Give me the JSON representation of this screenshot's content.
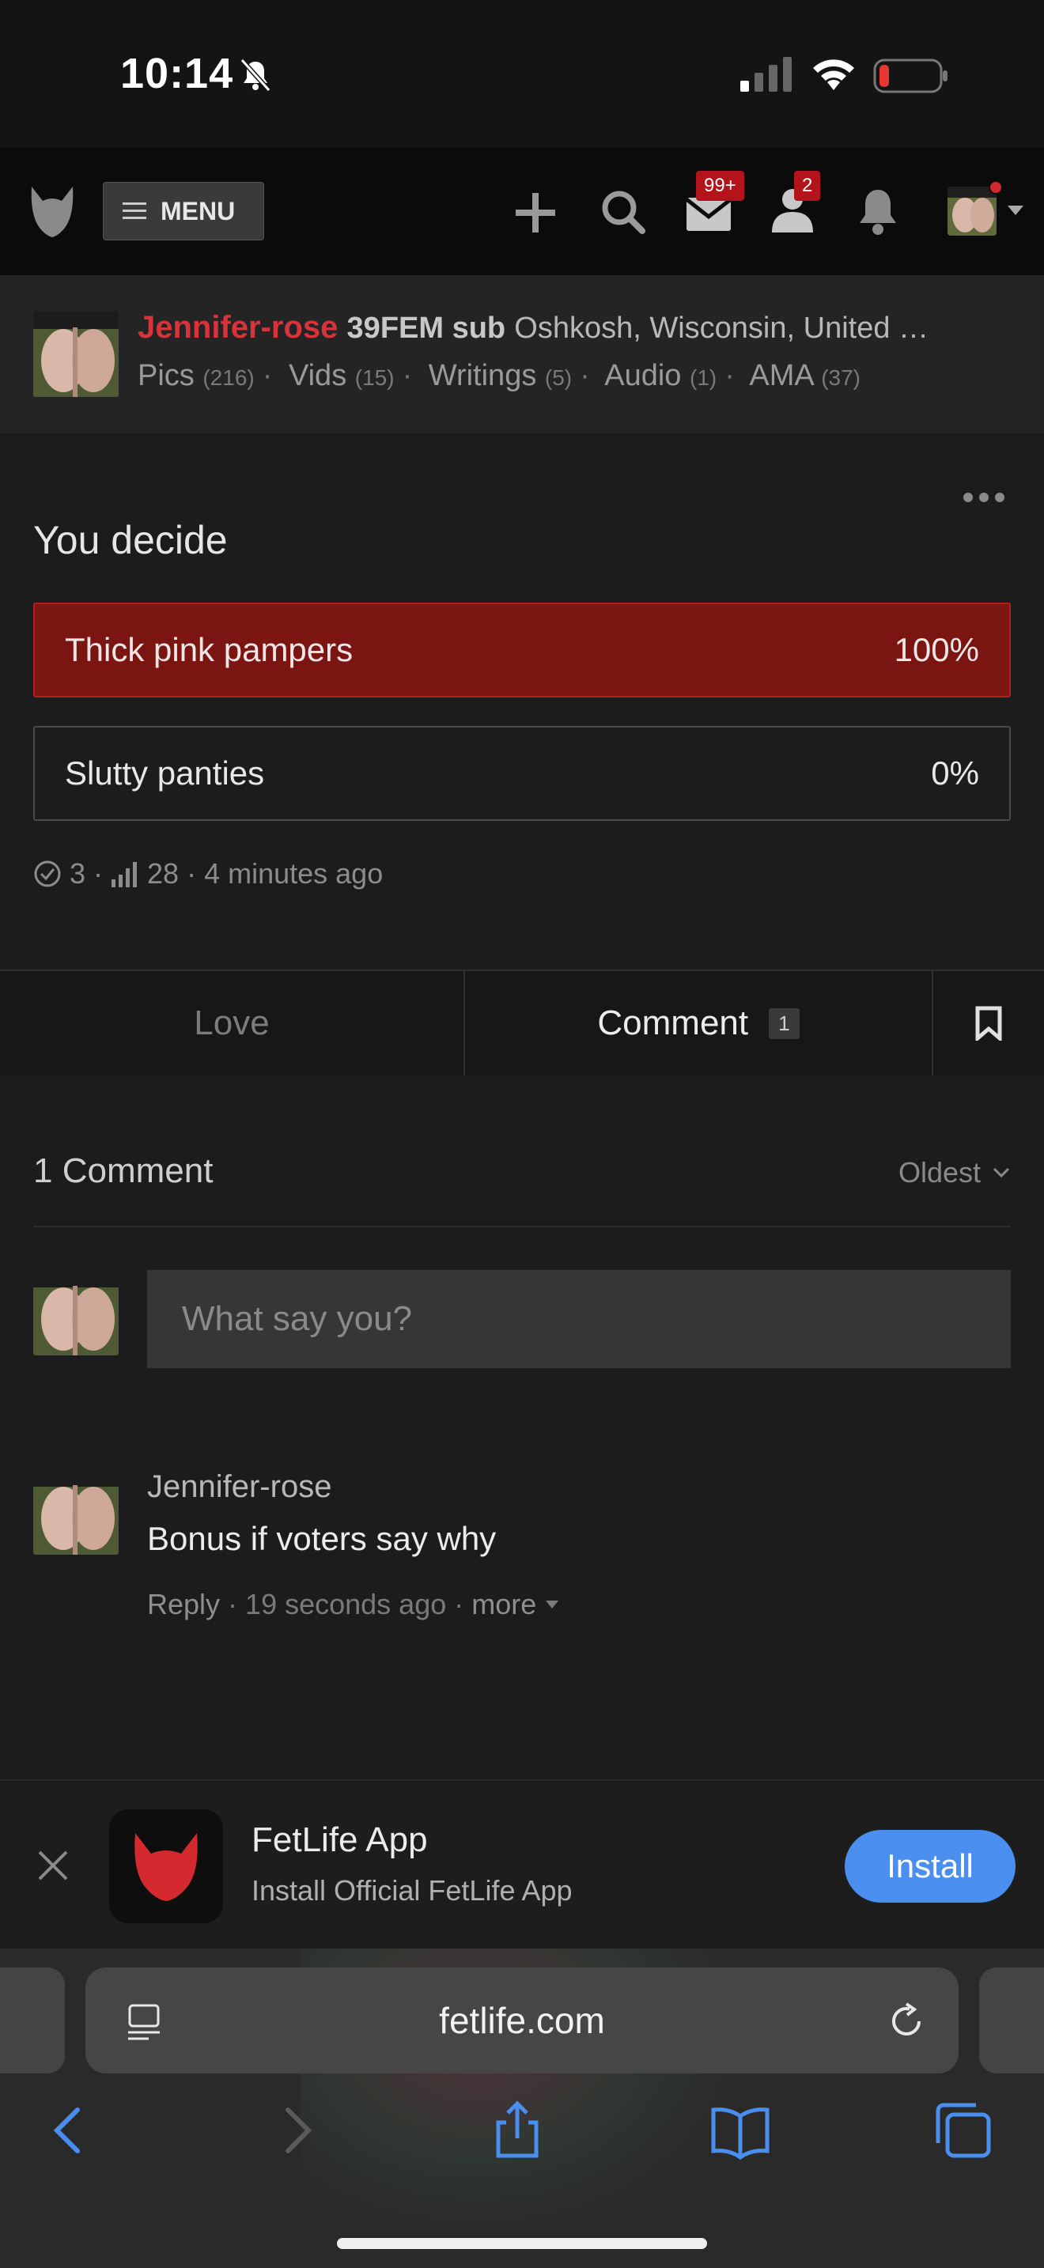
{
  "status_bar": {
    "time": "10:14"
  },
  "nav": {
    "menu_label": "MENU",
    "mail_badge": "99+",
    "people_badge": "2"
  },
  "profile": {
    "name": "Jennifer-rose",
    "meta": "39FEM sub",
    "location": "Oshkosh, Wisconsin, United …",
    "links": [
      {
        "label": "Pics",
        "count": "(216)"
      },
      {
        "label": "Vids",
        "count": "(15)"
      },
      {
        "label": "Writings",
        "count": "(5)"
      },
      {
        "label": "Audio",
        "count": "(1)"
      },
      {
        "label": "AMA",
        "count": "(37)"
      }
    ]
  },
  "poll": {
    "title": "You decide",
    "options": [
      {
        "label": "Thick pink pampers",
        "percent": "100%"
      },
      {
        "label": "Slutty panties",
        "percent": "0%"
      }
    ],
    "votes": "3",
    "views": "28",
    "time": "4 minutes ago"
  },
  "actions": {
    "love": "Love",
    "comment": "Comment",
    "comment_count": "1"
  },
  "comments": {
    "title": "1 Comment",
    "sort": "Oldest",
    "input_placeholder": "What say you?",
    "items": [
      {
        "author": "Jennifer-rose",
        "text": "Bonus if voters say why",
        "reply": "Reply",
        "time": "19 seconds ago",
        "more": "more"
      }
    ]
  },
  "app_banner": {
    "title": "FetLife App",
    "subtitle": "Install Official FetLife App",
    "install": "Install"
  },
  "browser": {
    "url": "fetlife.com"
  },
  "colors": {
    "accent_red": "#d6333a",
    "poll_selected": "#7a1512",
    "install_blue": "#4a8ff0"
  }
}
